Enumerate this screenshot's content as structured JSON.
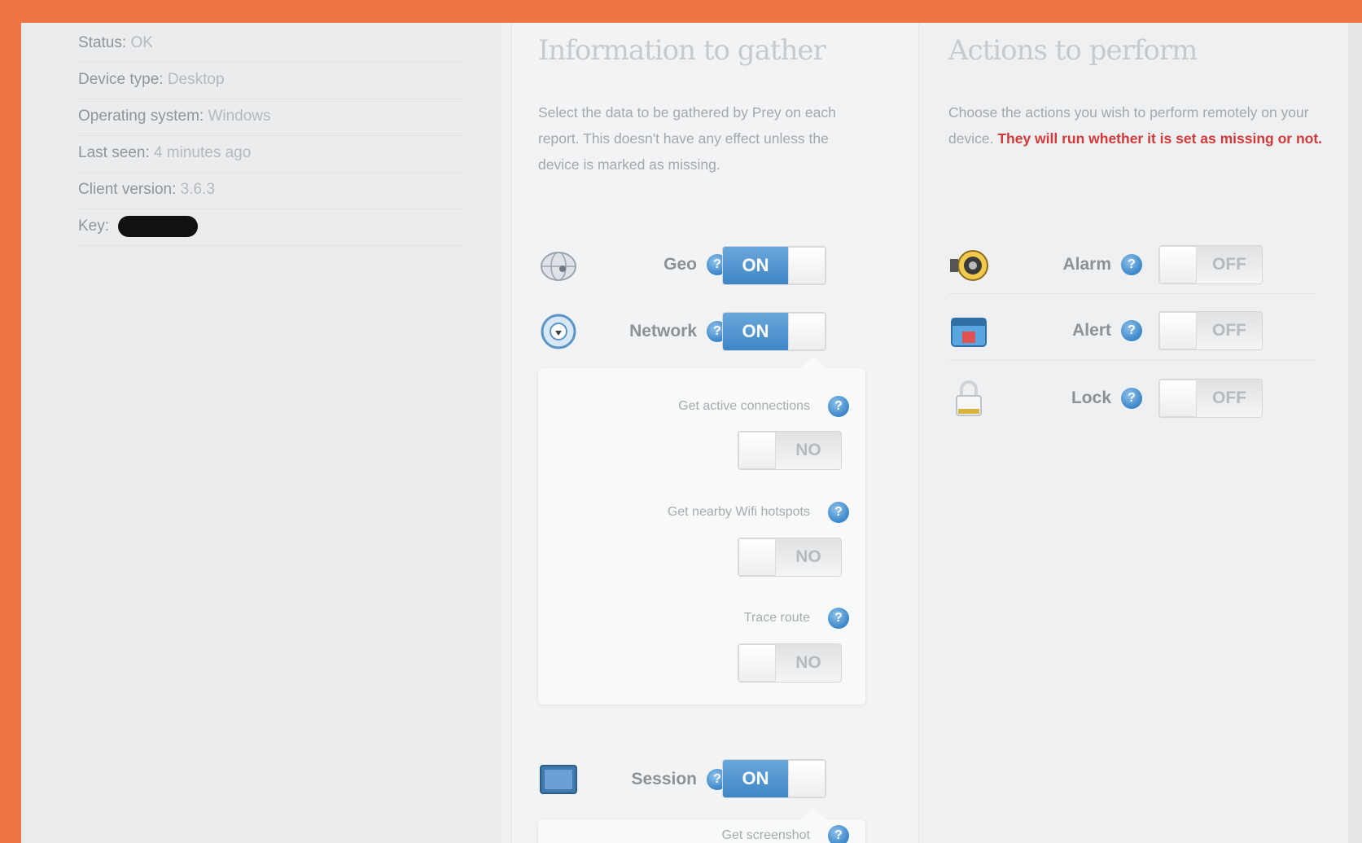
{
  "device_info": {
    "status_label": "Status:",
    "status_value": "OK",
    "device_type_label": "Device type:",
    "device_type_value": "Desktop",
    "os_label": "Operating system:",
    "os_value": "Windows",
    "last_seen_label": "Last seen:",
    "last_seen_value": "4 minutes ago",
    "client_version_label": "Client version:",
    "client_version_value": "3.6.3",
    "key_label": "Key:"
  },
  "information": {
    "title": "Information to gather",
    "description": "Select the data to be gathered by Prey on each report. This doesn't have any effect unless the device is marked as missing.",
    "modules": [
      {
        "label": "Geo",
        "icon": "globe-icon",
        "toggle": "ON"
      },
      {
        "label": "Network",
        "icon": "network-icon",
        "toggle": "ON",
        "options": [
          {
            "label": "Get active connections",
            "toggle": "NO"
          },
          {
            "label": "Get nearby Wifi hotspots",
            "toggle": "NO"
          },
          {
            "label": "Trace route",
            "toggle": "NO"
          }
        ]
      },
      {
        "label": "Session",
        "icon": "session-icon",
        "toggle": "ON",
        "options": [
          {
            "label": "Get screenshot"
          }
        ]
      }
    ]
  },
  "actions": {
    "title": "Actions to perform",
    "description": "Choose the actions you wish to perform remotely on your device.",
    "warning": "They will run whether it is set as missing or not.",
    "items": [
      {
        "label": "Alarm",
        "icon": "alarm-icon",
        "toggle": "OFF"
      },
      {
        "label": "Alert",
        "icon": "alert-icon",
        "toggle": "OFF"
      },
      {
        "label": "Lock",
        "icon": "lock-icon",
        "toggle": "OFF"
      }
    ]
  },
  "colors": {
    "frame": "#ef7343",
    "toggle_on": "#3f86c6",
    "warning": "#d23a3a"
  }
}
